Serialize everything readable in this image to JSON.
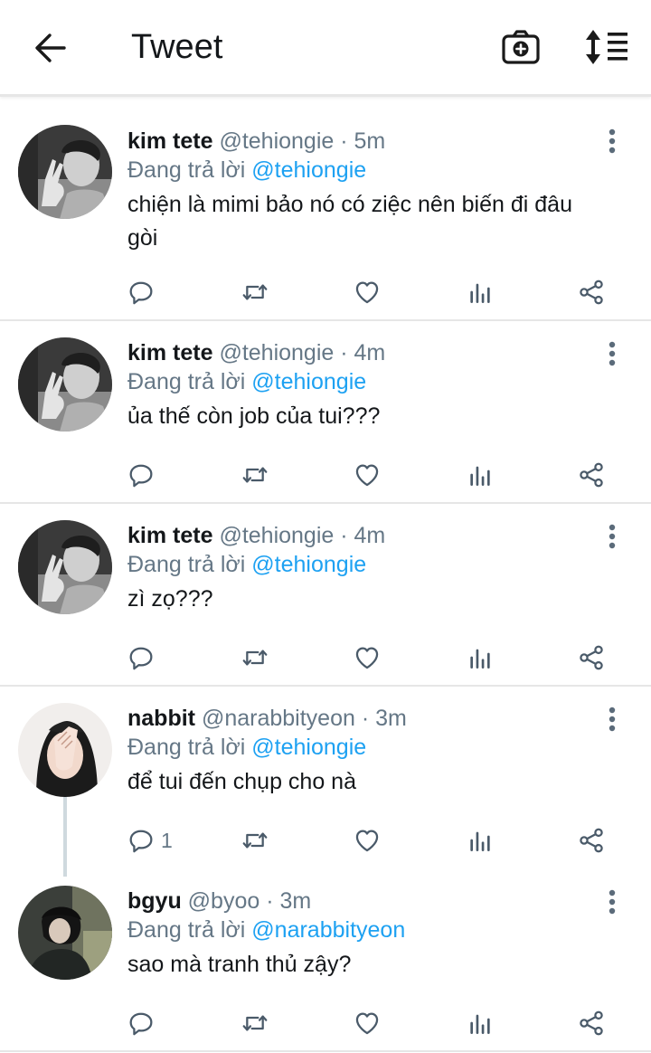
{
  "header": {
    "title": "Tweet",
    "back_icon": "arrow-left-icon",
    "camera_icon": "camera-plus-icon",
    "sort_icon": "sort-list-icon"
  },
  "colors": {
    "accent": "#1da1f2",
    "muted": "#657786",
    "text": "#14171a",
    "divider": "#e6e6e6",
    "icon": "#4a5a69"
  },
  "tweets": [
    {
      "name": "kim tete",
      "handle": "@tehiongie",
      "sep": "·",
      "time": "5m",
      "reply_prefix": "Đang trả lời",
      "reply_handle": "@tehiongie",
      "text": "chiện là mimi bảo nó có ziệc nên biến đi đâu gòi",
      "reply_count": ""
    },
    {
      "name": "kim tete",
      "handle": "@tehiongie",
      "sep": "·",
      "time": "4m",
      "reply_prefix": "Đang trả lời",
      "reply_handle": "@tehiongie",
      "text": "ủa thế còn job của tui???",
      "reply_count": ""
    },
    {
      "name": "kim tete",
      "handle": "@tehiongie",
      "sep": "·",
      "time": "4m",
      "reply_prefix": "Đang trả lời",
      "reply_handle": "@tehiongie",
      "text": "zì zọ???",
      "reply_count": ""
    },
    {
      "name": "nabbit",
      "handle": "@narabbityeon",
      "sep": "·",
      "time": "3m",
      "reply_prefix": "Đang trả lời",
      "reply_handle": "@tehiongie",
      "text": "để tui đến chụp cho nà",
      "reply_count": "1"
    },
    {
      "name": "bgyu",
      "handle": "@byoo",
      "sep": "·",
      "time": "3m",
      "reply_prefix": "Đang trả lời",
      "reply_handle": "@narabbityeon",
      "text": "sao mà tranh thủ zậy?",
      "reply_count": ""
    }
  ]
}
